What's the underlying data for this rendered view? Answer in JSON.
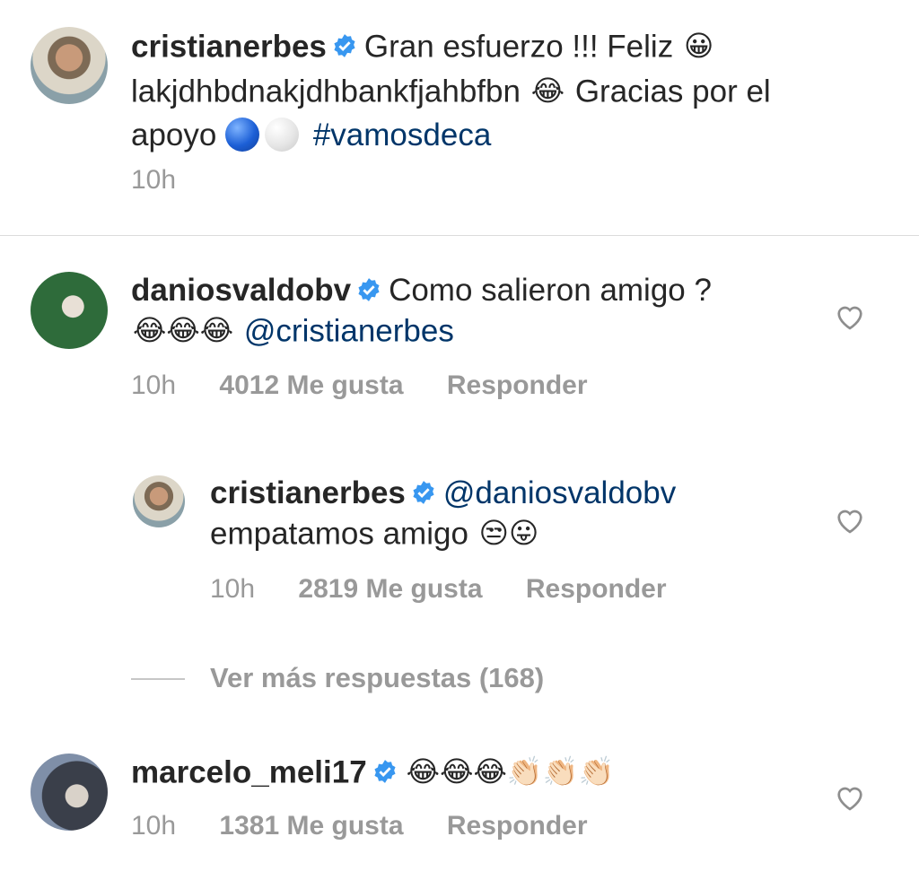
{
  "caption": {
    "username": "cristianerbes",
    "text_1": "Gran esfuerzo !!! Feliz",
    "text_2": "lakjdhbdnakjdhbankfjahbfbn",
    "text_3": "Gracias por el",
    "text_4": "apoyo",
    "hashtag": "#vamosdeca",
    "time": "10h",
    "emoji_grin": "😀",
    "emoji_joy": "😂"
  },
  "comments": [
    {
      "username": "daniosvaldobv",
      "text": "Como salieron amigo ?",
      "mention": "@cristianerbes",
      "emojis": "😂😂😂",
      "time": "10h",
      "likes": "4012 Me gusta",
      "reply": "Responder"
    },
    {
      "username": "cristianerbes",
      "mention": "@daniosvaldobv",
      "text": "empatamos amigo",
      "emojis": "😒😛",
      "time": "10h",
      "likes": "2819 Me gusta",
      "reply": "Responder"
    },
    {
      "username": "marcelo_meli17",
      "emojis": "😂😂😂👏🏻👏🏻👏🏻",
      "time": "10h",
      "likes": "1381 Me gusta",
      "reply": "Responder"
    }
  ],
  "view_more": "Ver más respuestas (168)",
  "colors": {
    "verified": "#3897f0",
    "link": "#003569",
    "meta": "#999999"
  },
  "icons": [
    "verified-badge-icon",
    "heart-icon"
  ]
}
